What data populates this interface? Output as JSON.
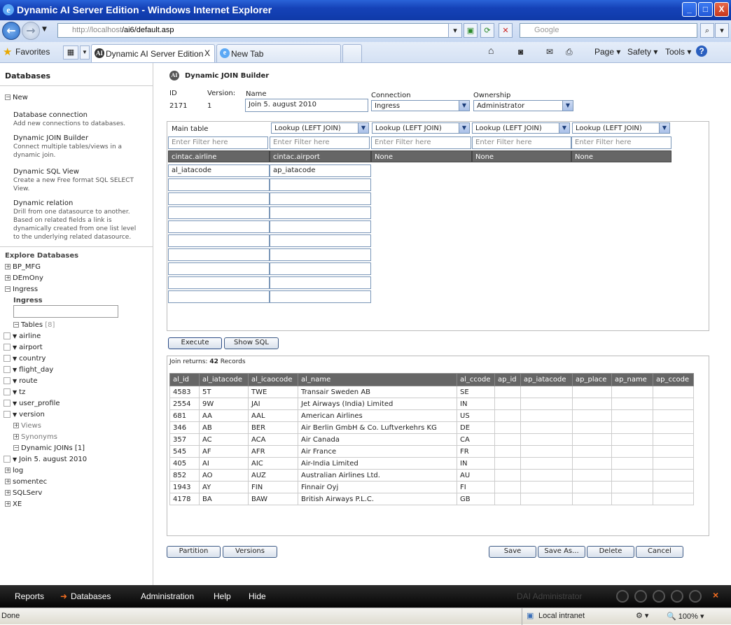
{
  "window": {
    "title": "Dynamic AI Server Edition - Windows Internet Explorer",
    "min": "_",
    "max": "□",
    "close": "X"
  },
  "browser": {
    "url_host": "http://localhost",
    "url_path": "/ai6/default.asp",
    "search_placeholder": "Google",
    "favorites": "Favorites",
    "tabs": [
      {
        "label": "Dynamic AI Server Edition",
        "close": "X"
      },
      {
        "label": "New Tab"
      }
    ],
    "commands": {
      "page": "Page",
      "safety": "Safety",
      "tools": "Tools"
    }
  },
  "sidebar": {
    "header": "Databases",
    "new_label": "New",
    "new_items": [
      {
        "title": "Database connection",
        "desc": "Add new connections to databases."
      },
      {
        "title": "Dynamic JOIN Builder",
        "desc": "Connect multiple tables/views in a dynamic join."
      },
      {
        "title": "Dynamic SQL View",
        "desc": "Create a new Free format SQL SELECT View."
      },
      {
        "title": "Dynamic relation",
        "desc": "Drill from one datasource to another. Based on related fields a link is dynamically created from one list level to the underlying related datasource."
      }
    ],
    "explore_title": "Explore Databases",
    "db1": "BP_MFG",
    "db2": "DEmOny",
    "db3": "Ingress",
    "db3_sub": "Ingress",
    "tables_label": "Tables",
    "tables_count": "[8]",
    "tables": [
      "airline",
      "airport",
      "country",
      "flight_day",
      "route",
      "tz",
      "user_profile",
      "version"
    ],
    "views": "Views",
    "synonyms": "Synonyms",
    "joins": "Dynamic JOINs [1]",
    "join_item": "Join 5. august 2010",
    "more_dbs": [
      "log",
      "somentec",
      "SQLServ",
      "XE"
    ]
  },
  "builder": {
    "title": "Dynamic JOIN Builder",
    "id_label": "ID",
    "id_value": "2171",
    "version_label": "Version:",
    "version_value": "1",
    "name_label": "Name",
    "name_value": "Join 5. august 2010",
    "connection_label": "Connection",
    "connection_value": "Ingress",
    "ownership_label": "Ownership",
    "ownership_value": "Administrator",
    "main_table_label": "Main table",
    "lookup_option": "Lookup (LEFT JOIN)",
    "filter_placeholder": "Enter Filter here",
    "table_headers": [
      "cintac.airline",
      "cintac.airport",
      "None",
      "None",
      "None"
    ],
    "fields_col1": [
      "al_iatacode"
    ],
    "fields_col2": [
      "ap_iatacode"
    ],
    "execute": "Execute",
    "show_sql": "Show SQL"
  },
  "results": {
    "summary_prefix": "Join returns:",
    "count": "42",
    "summary_suffix": "Records",
    "columns": [
      "al_id",
      "al_iatacode",
      "al_icaocode",
      "al_name",
      "al_ccode",
      "ap_id",
      "ap_iatacode",
      "ap_place",
      "ap_name",
      "ap_ccode"
    ],
    "rows": [
      [
        "4583",
        "5T",
        "TWE",
        "Transair Sweden AB",
        "SE",
        "",
        "",
        "",
        "",
        ""
      ],
      [
        "2554",
        "9W",
        "JAI",
        "Jet Airways (India) Limited",
        "IN",
        "",
        "",
        "",
        "",
        ""
      ],
      [
        "681",
        "AA",
        "AAL",
        "American Airlines",
        "US",
        "",
        "",
        "",
        "",
        ""
      ],
      [
        "346",
        "AB",
        "BER",
        "Air Berlin GmbH & Co. Luftverkehrs KG",
        "DE",
        "",
        "",
        "",
        "",
        ""
      ],
      [
        "357",
        "AC",
        "ACA",
        "Air Canada",
        "CA",
        "",
        "",
        "",
        "",
        ""
      ],
      [
        "545",
        "AF",
        "AFR",
        "Air France",
        "FR",
        "",
        "",
        "",
        "",
        ""
      ],
      [
        "405",
        "AI",
        "AIC",
        "Air-India Limited",
        "IN",
        "",
        "",
        "",
        "",
        ""
      ],
      [
        "852",
        "AO",
        "AUZ",
        "Australian Airlines Ltd.",
        "AU",
        "",
        "",
        "",
        "",
        ""
      ],
      [
        "1943",
        "AY",
        "FIN",
        "Finnair Oyj",
        "FI",
        "",
        "",
        "",
        "",
        ""
      ],
      [
        "4178",
        "BA",
        "BAW",
        "British Airways P.L.C.",
        "GB",
        "",
        "",
        "",
        "",
        ""
      ]
    ]
  },
  "actions": {
    "partition": "Partition",
    "versions": "Versions",
    "save": "Save",
    "save_as": "Save As...",
    "delete": "Delete",
    "cancel": "Cancel"
  },
  "bottom_nav": {
    "reports": "Reports",
    "databases": "Databases",
    "administration": "Administration",
    "help": "Help",
    "hide": "Hide",
    "user": "DAI Administrator",
    "close": "×"
  },
  "status": {
    "left": "Done",
    "zone": "Local intranet",
    "zoom": "100%"
  }
}
